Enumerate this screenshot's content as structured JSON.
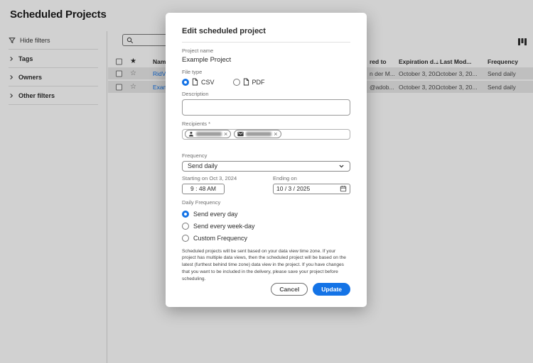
{
  "colors": {
    "accent": "#1473e6",
    "row_stripe": "#e9e9e9"
  },
  "icons": {
    "star_filled": "★",
    "star_outline": "☆",
    "sort_desc": "↓",
    "close": "×"
  },
  "page": {
    "title": "Scheduled Projects"
  },
  "sidebar": {
    "hide_filters": "Hide filters",
    "sections": [
      {
        "label": "Tags"
      },
      {
        "label": "Owners"
      },
      {
        "label": "Other filters"
      }
    ]
  },
  "search": {
    "value": "",
    "placeholder": ""
  },
  "table": {
    "header": {
      "name": "Name",
      "delivered": "red to",
      "expiration": "Expiration d...",
      "last_modified": "Last Mod...",
      "frequency": "Frequency"
    },
    "rows": [
      {
        "name": "RidV...",
        "delivered": "n der M...",
        "expiration": "October 3, 20...",
        "last_modified": "October 3, 20...",
        "frequency": "Send daily"
      },
      {
        "name": "Exam...",
        "delivered": "@adob...",
        "expiration": "October 3, 20...",
        "last_modified": "October 3, 20...",
        "frequency": "Send daily"
      }
    ]
  },
  "modal": {
    "title": "Edit scheduled project",
    "project_name_label": "Project name",
    "project_name_value": "Example Project",
    "file_type_label": "File type",
    "file_types": [
      {
        "label": "CSV",
        "selected": true
      },
      {
        "label": "PDF",
        "selected": false
      }
    ],
    "description_label": "Description",
    "description_value": "",
    "recipients_label": "Recipients *",
    "frequency_label": "Frequency",
    "frequency_value": "Send daily",
    "starting_label": "Starting on Oct 3, 2024",
    "starting_time": "9 : 48  AM",
    "ending_label": "Ending on",
    "ending_date": "10 /  3 / 2025",
    "daily_frequency_label": "Daily Frequency",
    "daily_options": [
      {
        "label": "Send every day",
        "selected": true
      },
      {
        "label": "Send every week-day",
        "selected": false
      },
      {
        "label": "Custom Frequency",
        "selected": false
      }
    ],
    "disclaimer": "Scheduled projects will be sent based on your data view time zone. If your project has multiple data views, then the scheduled project will be based on the latest (furthest behind time zone) data view in the project. If you have changes that you want to be included in the delivery, please save your project before scheduling.",
    "cancel_label": "Cancel",
    "update_label": "Update"
  }
}
